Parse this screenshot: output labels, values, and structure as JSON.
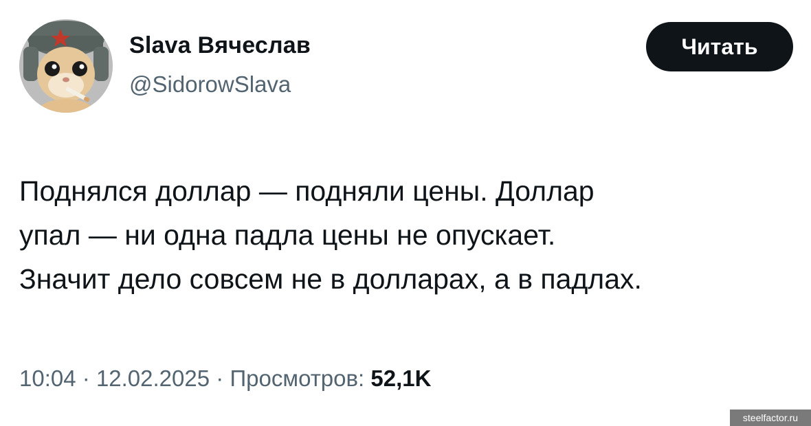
{
  "author": {
    "display_name": "Slava Вячеслав",
    "handle": "@SidorowSlava",
    "avatar_icon": "cat-with-cigarette-avatar"
  },
  "follow_button": {
    "label": "Читать"
  },
  "tweet": {
    "lines": [
      "Поднялся доллар — подняли цены. Доллар",
      "упал — ни одна падла цены не опускает.",
      "Значит дело совсем не в долларах, а в падлах."
    ]
  },
  "meta": {
    "time": "10:04",
    "separator": "·",
    "date": "12.02.2025",
    "views_label": "Просмотров:",
    "views_count": "52,1K"
  },
  "watermark": {
    "text": "steelfactor.ru"
  },
  "colors": {
    "text_primary": "#0f1419",
    "text_secondary": "#536471",
    "button_bg": "#0f1419",
    "button_text": "#ffffff"
  }
}
